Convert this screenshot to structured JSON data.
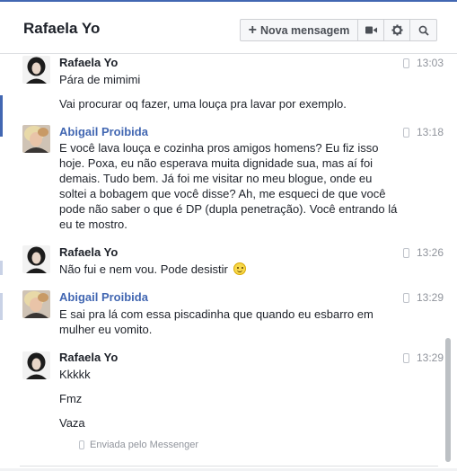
{
  "header": {
    "title": "Rafaela Yo",
    "new_message_label": "Nova mensagem",
    "icons": [
      "video-call-icon",
      "gear-icon",
      "search-icon"
    ]
  },
  "messages": [
    {
      "sender": "Rafaela Yo",
      "time": "13:03",
      "paragraphs": [
        "Pára de mimimi",
        "Vai procurar oq fazer, uma louça pra lavar por exemplo."
      ]
    },
    {
      "sender": "Abigail Proibida",
      "time": "13:18",
      "paragraphs": [
        "E você lava louça e cozinha pros amigos homens? Eu fiz isso hoje. Poxa, eu não esperava muita dignidade sua, mas aí foi demais. Tudo bem. Já foi me visitar no meu blogue, onde eu soltei a bobagem que você disse? Ah, me esqueci de que você pode não saber o que é DP (dupla penetração). Você entrando lá eu te mostro."
      ]
    },
    {
      "sender": "Rafaela Yo",
      "time": "13:26",
      "paragraphs": [
        "Não fui e nem vou. Pode desistir"
      ]
    },
    {
      "sender": "Abigail Proibida",
      "time": "13:29",
      "paragraphs": [
        "E sai pra lá com essa piscadinha que quando eu esbarro em mulher eu vomito."
      ]
    },
    {
      "sender": "Rafaela Yo",
      "time": "13:29",
      "paragraphs": [
        "Kkkkk",
        "Fmz",
        "Vaza"
      ]
    }
  ],
  "footer": {
    "sent_via": "Enviada pelo Messenger"
  },
  "colors": {
    "accent": "#4267b2",
    "text": "#1d2129",
    "muted": "#90949c"
  }
}
